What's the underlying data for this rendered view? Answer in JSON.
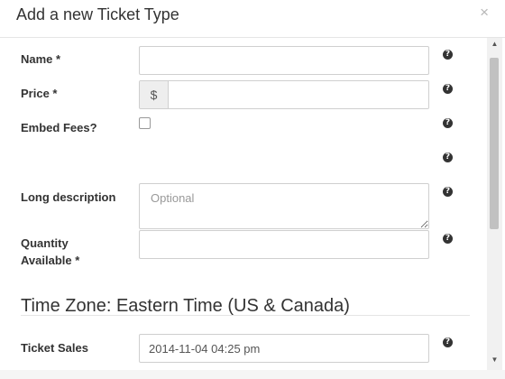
{
  "modal": {
    "title": "Add a new Ticket Type",
    "close_label": "×"
  },
  "form": {
    "name_label": "Name *",
    "price_label": "Price *",
    "price_currency": "$",
    "embed_label": "Embed Fees?",
    "long_desc_label": "Long description",
    "long_desc_placeholder": "Optional",
    "qty_label_line1": "Quantity",
    "qty_label_line2": "Available *",
    "tz_title": "Time Zone: Eastern Time (US & Canada)",
    "ticket_sales_label": "Ticket Sales",
    "ticket_sales_value": "2014-11-04 04:25 pm",
    "help_glyph": "?"
  },
  "scrollbar": {
    "up_glyph": "▲",
    "down_glyph": "▼"
  }
}
